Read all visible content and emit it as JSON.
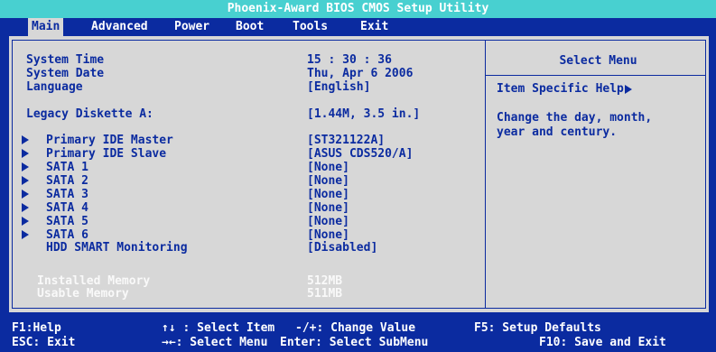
{
  "title": "Phoenix-Award BIOS CMOS Setup Utility",
  "menu": {
    "tabs": [
      {
        "label": "Main"
      },
      {
        "label": "Advanced"
      },
      {
        "label": "Power"
      },
      {
        "label": "Boot"
      },
      {
        "label": "Tools"
      },
      {
        "label": "Exit"
      }
    ]
  },
  "settings": {
    "system_time": {
      "label": "System Time",
      "value": "15 : 30 : 36"
    },
    "system_date": {
      "label": "System Date",
      "value": "Thu, Apr 6  2006"
    },
    "language": {
      "label": "Language",
      "value": "[English]"
    },
    "legacy_diskette": {
      "label": "Legacy Diskette A:",
      "value": "[1.44M, 3.5 in.]"
    },
    "devices": [
      {
        "label": "Primary IDE Master",
        "value": "[ST321122A]"
      },
      {
        "label": "Primary IDE Slave",
        "value": "[ASUS CDS520/A]"
      },
      {
        "label": "SATA 1",
        "value": "[None]"
      },
      {
        "label": "SATA 2",
        "value": "[None]"
      },
      {
        "label": "SATA 3",
        "value": "[None]"
      },
      {
        "label": "SATA 4",
        "value": "[None]"
      },
      {
        "label": "SATA 5",
        "value": "[None]"
      },
      {
        "label": "SATA 6",
        "value": "[None]"
      }
    ],
    "hdd_smart": {
      "label": "HDD SMART Monitoring",
      "value": "[Disabled]"
    },
    "installed_memory": {
      "label": "Installed Memory",
      "value": "512MB"
    },
    "usable_memory": {
      "label": "Usable Memory",
      "value": "511MB"
    }
  },
  "help": {
    "title": "Select Menu",
    "item_help": "Item Specific Help",
    "text": "Change the day, month,\nyear and century."
  },
  "footer": {
    "row1": [
      {
        "key": "F1:Help"
      },
      {
        "key": "↑↓ : Select Item"
      },
      {
        "key": "-/+: Change Value"
      },
      {
        "key": "F5: Setup Defaults"
      }
    ],
    "row2": [
      {
        "key": "ESC: Exit"
      },
      {
        "key": "→←: Select Menu"
      },
      {
        "key": "Enter: Select SubMenu"
      },
      {
        "key": "F10: Save and Exit"
      }
    ]
  },
  "colors": {
    "bios_blue": "#0b2ba0",
    "panel_gray": "#d7d7d7",
    "title_cyan": "#48d0d0"
  }
}
